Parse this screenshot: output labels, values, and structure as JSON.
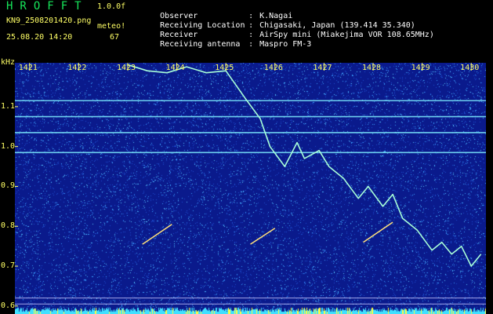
{
  "header": {
    "logo": "HROFFT",
    "version": "1.0.0f",
    "filename": "KN9_2508201420.png",
    "datetime": "25.08.20 14:20",
    "meteo_label": "meteo!",
    "meteo_count": "67"
  },
  "info": [
    {
      "key": "Observer",
      "value": "K.Nagai"
    },
    {
      "key": "Receiving Location",
      "value": "Chigasaki, Japan (139.414 35.340)"
    },
    {
      "key": "Receiver",
      "value": "AirSpy mini (Miakejima VOR 108.65MHz)"
    },
    {
      "key": "Receiving antenna",
      "value": "Maspro FM-3"
    }
  ],
  "chart_data": {
    "type": "heatmap",
    "ylabel": "kHz",
    "y_ticks": [
      "1.1",
      "1.0",
      "0.9",
      "0.8",
      "0.7",
      "0.6"
    ],
    "ylim": [
      0.58,
      1.21
    ],
    "x_ticks": [
      "1421",
      "1422",
      "1423",
      "1424",
      "1425",
      "1426",
      "1427",
      "1428",
      "1429",
      "1430"
    ],
    "xlim": [
      1420.7,
      1430.3
    ],
    "colors": {
      "background": "#0a1a8c",
      "noise": "#3aa0ff",
      "signal": "#a8ffd8",
      "axis": "#ffff66"
    },
    "carrier_lines_khz": [
      1.115,
      1.075,
      1.035,
      0.985
    ],
    "floor_lines_khz": [
      0.62,
      0.605
    ],
    "doppler_trace": [
      {
        "t": 1423.0,
        "f": 1.205
      },
      {
        "t": 1423.4,
        "f": 1.19
      },
      {
        "t": 1423.8,
        "f": 1.185
      },
      {
        "t": 1424.2,
        "f": 1.2
      },
      {
        "t": 1424.6,
        "f": 1.185
      },
      {
        "t": 1425.0,
        "f": 1.19
      },
      {
        "t": 1425.4,
        "f": 1.12
      },
      {
        "t": 1425.7,
        "f": 1.07
      },
      {
        "t": 1425.9,
        "f": 1.0
      },
      {
        "t": 1426.2,
        "f": 0.95
      },
      {
        "t": 1426.45,
        "f": 1.01
      },
      {
        "t": 1426.6,
        "f": 0.97
      },
      {
        "t": 1426.9,
        "f": 0.99
      },
      {
        "t": 1427.1,
        "f": 0.95
      },
      {
        "t": 1427.4,
        "f": 0.92
      },
      {
        "t": 1427.7,
        "f": 0.87
      },
      {
        "t": 1427.9,
        "f": 0.9
      },
      {
        "t": 1428.2,
        "f": 0.85
      },
      {
        "t": 1428.4,
        "f": 0.88
      },
      {
        "t": 1428.6,
        "f": 0.82
      },
      {
        "t": 1428.9,
        "f": 0.79
      },
      {
        "t": 1429.2,
        "f": 0.74
      },
      {
        "t": 1429.4,
        "f": 0.76
      },
      {
        "t": 1429.6,
        "f": 0.73
      },
      {
        "t": 1429.8,
        "f": 0.75
      },
      {
        "t": 1430.0,
        "f": 0.7
      },
      {
        "t": 1430.2,
        "f": 0.73
      }
    ],
    "meteor_echoes": [
      {
        "t1": 1423.3,
        "f1": 0.755,
        "t2": 1423.9,
        "f2": 0.805
      },
      {
        "t1": 1425.5,
        "f1": 0.755,
        "t2": 1426.0,
        "f2": 0.795
      },
      {
        "t1": 1427.8,
        "f1": 0.76,
        "t2": 1428.4,
        "f2": 0.81
      }
    ]
  }
}
